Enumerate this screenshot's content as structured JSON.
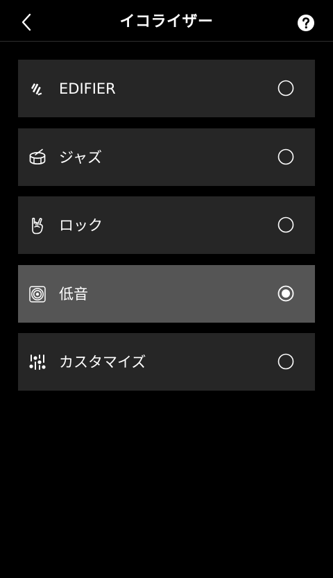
{
  "header": {
    "title": "イコライザー"
  },
  "colors": {
    "background": "#000000",
    "item_background": "#262626",
    "item_selected_background": "#555555",
    "text": "#ffffff"
  },
  "presets": [
    {
      "label": "EDIFIER",
      "icon": "edifier-logo-icon",
      "selected": false
    },
    {
      "label": "ジャズ",
      "icon": "drum-icon",
      "selected": false
    },
    {
      "label": "ロック",
      "icon": "rock-hand-icon",
      "selected": false
    },
    {
      "label": "低音",
      "icon": "speaker-icon",
      "selected": true
    },
    {
      "label": "カスタマイズ",
      "icon": "sliders-icon",
      "selected": false
    }
  ]
}
